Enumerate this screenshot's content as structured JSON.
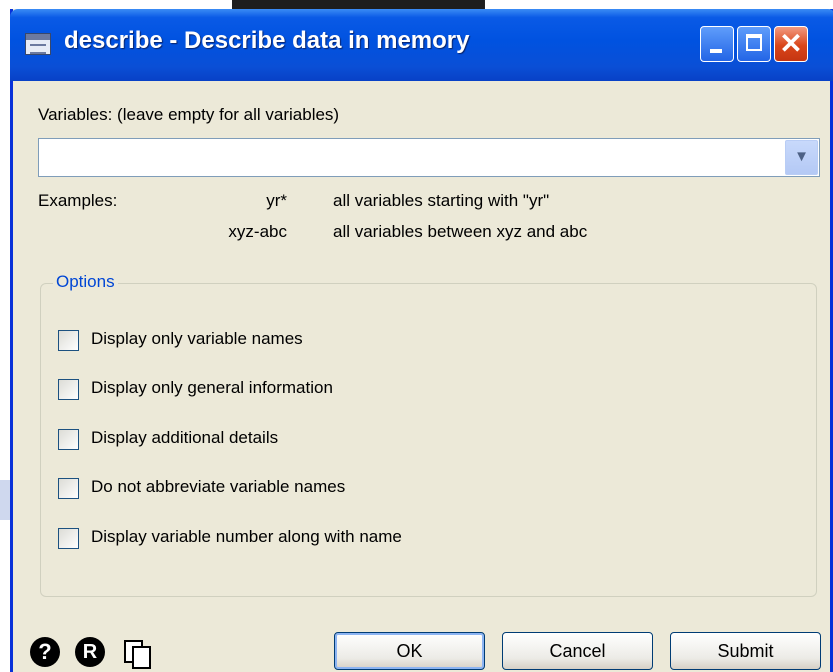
{
  "window": {
    "title": "describe - Describe data in memory",
    "controls": [
      "minimize-icon",
      "maximize-icon",
      "close-icon"
    ]
  },
  "variables": {
    "label": "Variables: (leave empty for all variables)",
    "value": "",
    "dropdown_icon": "chevron-down-icon"
  },
  "examples": {
    "heading": "Examples:",
    "rows": [
      {
        "pattern": "yr*",
        "description": "all variables starting with \"yr\""
      },
      {
        "pattern": "xyz-abc",
        "description": "all variables between xyz and abc"
      }
    ]
  },
  "options": {
    "title": "Options",
    "items": [
      {
        "label": "Display only variable names",
        "checked": false
      },
      {
        "label": "Display only general information",
        "checked": false
      },
      {
        "label": "Display additional details",
        "checked": false
      },
      {
        "label": "Do not abbreviate variable names",
        "checked": false
      },
      {
        "label": "Display variable number along with name",
        "checked": false
      }
    ]
  },
  "footer": {
    "icons": [
      "help-icon",
      "reset-icon",
      "copy-command-icon"
    ],
    "help_glyph": "?",
    "reset_glyph": "R",
    "ok": "OK",
    "cancel": "Cancel",
    "submit": "Submit"
  },
  "colors": {
    "titlebar": "#0a5ae6",
    "dialog_bg": "#ece9d8",
    "group_title": "#0046d5",
    "close_button": "#d9461a"
  }
}
